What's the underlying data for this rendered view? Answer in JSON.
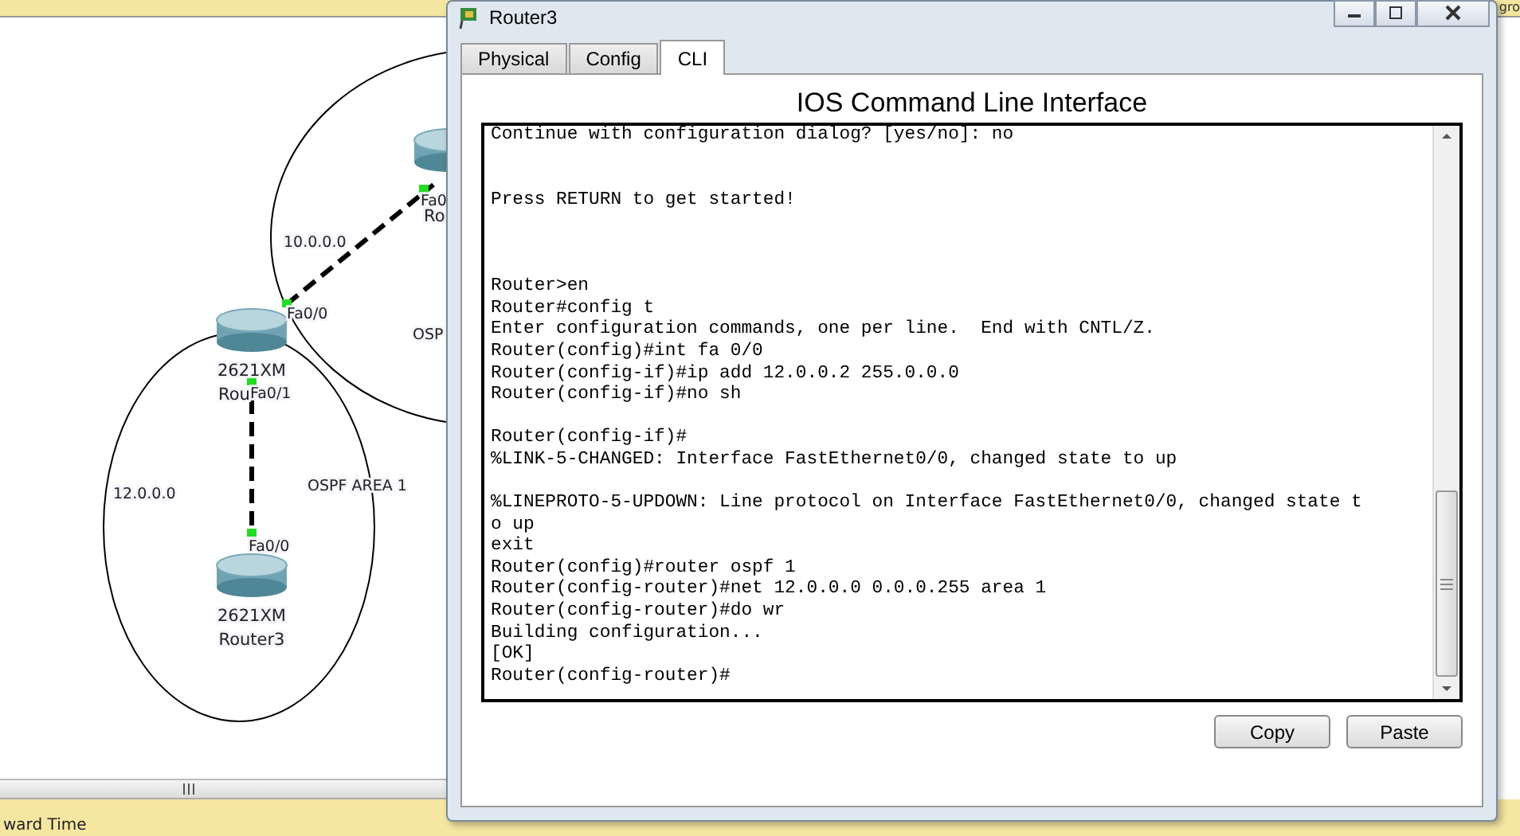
{
  "corner_text": "gro",
  "topology": {
    "devices": [
      {
        "model": "2621XM",
        "name": "Rou"
      },
      {
        "model": "2621XM",
        "name": "Router3"
      },
      {
        "name": "Ro"
      }
    ],
    "interfaces": [
      "Fa0",
      "Fa0/0",
      "Fa0/1",
      "Fa0/0"
    ],
    "network_labels": [
      "10.0.0.0",
      "12.0.0.0"
    ],
    "area_labels": [
      "OSP",
      "OSPF AREA 1"
    ]
  },
  "status_bar": {
    "text": "ward Time"
  },
  "window": {
    "title": "Router3",
    "tabs": [
      {
        "label": "Physical",
        "selected": false
      },
      {
        "label": "Config",
        "selected": false
      },
      {
        "label": "CLI",
        "selected": true
      }
    ],
    "heading": "IOS Command Line Interface",
    "terminal_lines": [
      {
        "kind": "text",
        "text": "Continue with configuration dialog? [yes/no]: no"
      },
      {
        "kind": "blank"
      },
      {
        "kind": "blank"
      },
      {
        "kind": "text",
        "text": "Press RETURN to get started!"
      },
      {
        "kind": "blank"
      },
      {
        "kind": "blank"
      },
      {
        "kind": "blank"
      },
      {
        "kind": "text",
        "text": "Router>en"
      },
      {
        "kind": "text",
        "text": "Router#config t"
      },
      {
        "kind": "text",
        "text": "Enter configuration commands, one per line.  End with CNTL/Z."
      },
      {
        "kind": "text",
        "text": "Router(config)#int fa 0/0"
      },
      {
        "kind": "text",
        "text": "Router(config-if)#ip add 12.0.0.2 255.0.0.0"
      },
      {
        "kind": "text",
        "text": "Router(config-if)#no sh"
      },
      {
        "kind": "blank"
      },
      {
        "kind": "text",
        "text": "Router(config-if)#"
      },
      {
        "kind": "text",
        "text": "%LINK-5-CHANGED: Interface FastEthernet0/0, changed state to up"
      },
      {
        "kind": "blank"
      },
      {
        "kind": "text",
        "text": "%LINEPROTO-5-UPDOWN: Line protocol on Interface FastEthernet0/0, changed state t"
      },
      {
        "kind": "text",
        "text": "o up"
      },
      {
        "kind": "text",
        "text": "exit"
      },
      {
        "kind": "text",
        "text": "Router(config)#router ospf 1"
      },
      {
        "kind": "text",
        "text": "Router(config-router)#net 12.0.0.0 0.0.0.255 area 1"
      },
      {
        "kind": "text",
        "text": "Router(config-router)#do wr"
      },
      {
        "kind": "text",
        "text": "Building configuration..."
      },
      {
        "kind": "text",
        "text": "[OK]"
      },
      {
        "kind": "text",
        "text": "Router(config-router)#"
      }
    ],
    "buttons": [
      "Copy",
      "Paste"
    ]
  }
}
